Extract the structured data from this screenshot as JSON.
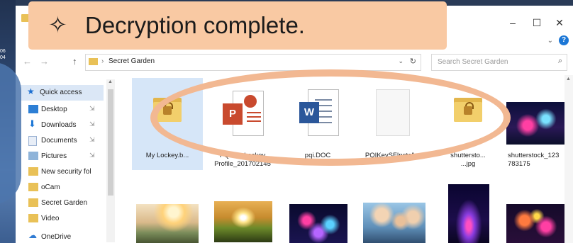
{
  "overlay": {
    "banner_icon_glyph": "✧",
    "banner_text": "Decryption complete."
  },
  "desktop": {
    "time_line1": "06",
    "time_line2": "04"
  },
  "window": {
    "controls": {
      "minimize": "–",
      "maximize": "☐",
      "close": "✕"
    },
    "help_chevron": "⌄",
    "help_icon": "?"
  },
  "address_bar": {
    "separator": "›",
    "path": "Secret Garden",
    "dropdown_glyph": "⌄",
    "refresh_glyph": "↻",
    "search_placeholder": "Search Secret Garden",
    "search_glyph": "⌕",
    "nav": {
      "back": "←",
      "forward": "→",
      "up": "↑"
    }
  },
  "nav_pane": {
    "items": [
      {
        "label": "Quick access",
        "icon": "star-icon",
        "pinned": false
      },
      {
        "label": "Desktop",
        "icon": "desktop-icon",
        "pinned": true
      },
      {
        "label": "Downloads",
        "icon": "download-icon",
        "pinned": true
      },
      {
        "label": "Documents",
        "icon": "documents-icon",
        "pinned": true
      },
      {
        "label": "Pictures",
        "icon": "pictures-icon",
        "pinned": true
      },
      {
        "label": "New security fol",
        "icon": "folder-icon",
        "pinned": false
      },
      {
        "label": "oCam",
        "icon": "folder-icon",
        "pinned": false
      },
      {
        "label": "Secret Garden",
        "icon": "folder-icon",
        "pinned": false
      },
      {
        "label": "Video",
        "icon": "folder-icon",
        "pinned": false
      },
      {
        "label": "OneDrive",
        "icon": "cloud-icon",
        "pinned": false
      }
    ],
    "pin_glyph": "⇲",
    "star_glyph": "★",
    "download_glyph": "⬇",
    "cloud_glyph": "☁"
  },
  "files": {
    "row1": [
      {
        "name": "My Lockey.b...",
        "type": "locked-folder"
      },
      {
        "name": "PQI My Lockey Product Profile_201702145",
        "name_line1": "PQI My Lockey",
        "name_line2": "Produ...",
        "name_line3": "Profile_201702145",
        "type": "pptx"
      },
      {
        "name": "pqi.DOC",
        "type": "doc"
      },
      {
        "name": "PQIKeySFInstaller",
        "type": "blank"
      },
      {
        "name": "shutterstock_...jpg",
        "name_line1": "shuttersto...",
        "name_line2": "...jpg",
        "type": "locked-folder"
      },
      {
        "name": "shutterstock_123783175",
        "name_line1": "shutterstock_123",
        "name_line2": "783175",
        "type": "photo"
      }
    ],
    "row2_count_visible": 7
  },
  "colors": {
    "banner_bg": "#f9c9a3",
    "ellipse_stroke": "#f2b892",
    "selection": "#d6e6f8",
    "ppt_red": "#c94a2e",
    "word_blue": "#2b579a"
  },
  "icons": {
    "ppt_badge": "P",
    "doc_badge": "W"
  }
}
